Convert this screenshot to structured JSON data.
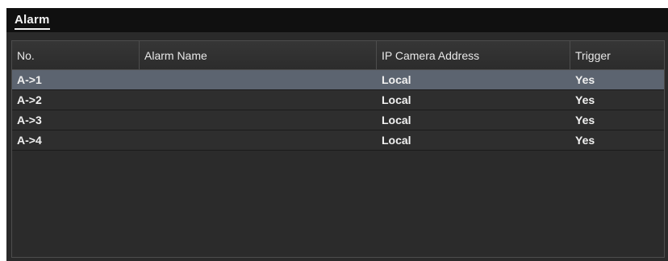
{
  "window": {
    "tab_label": "Alarm"
  },
  "table": {
    "columns": [
      "No.",
      "Alarm Name",
      "IP Camera Address",
      "Trigger"
    ],
    "rows": [
      {
        "no": "A->1",
        "name": "",
        "address": "Local",
        "trigger": "Yes",
        "selected": true
      },
      {
        "no": "A->2",
        "name": "",
        "address": "Local",
        "trigger": "Yes",
        "selected": false
      },
      {
        "no": "A->3",
        "name": "",
        "address": "Local",
        "trigger": "Yes",
        "selected": false
      },
      {
        "no": "A->4",
        "name": "",
        "address": "Local",
        "trigger": "Yes",
        "selected": false
      }
    ]
  },
  "colors": {
    "header_bar": "#101010",
    "panel": "#2a2a2a",
    "selected_row": "#5c6470",
    "text": "#f0f0f0"
  }
}
